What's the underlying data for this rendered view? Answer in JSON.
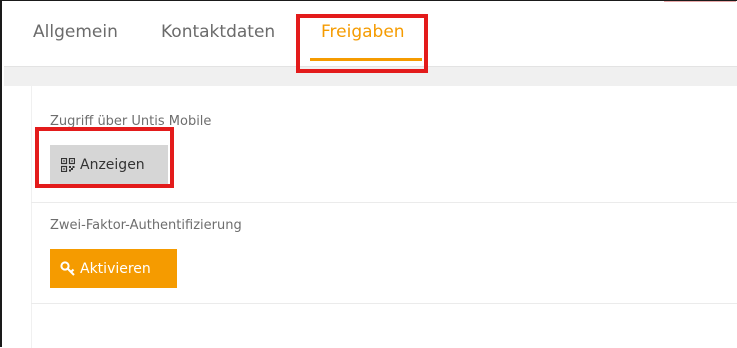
{
  "tabs": [
    {
      "label": "Allgemein",
      "active": false
    },
    {
      "label": "Kontaktdaten",
      "active": false
    },
    {
      "label": "Freigaben",
      "active": true
    }
  ],
  "sections": {
    "mobile": {
      "label": "Zugriff über Untis Mobile",
      "button_label": "Anzeigen",
      "button_icon": "qr-code-icon"
    },
    "two_factor": {
      "label": "Zwei-Faktor-Authentifizierung",
      "button_label": "Aktivieren",
      "button_icon": "key-icon"
    }
  },
  "colors": {
    "accent": "#f59b00",
    "highlight": "#e31b1b",
    "button_gray": "#d6d6d6"
  }
}
